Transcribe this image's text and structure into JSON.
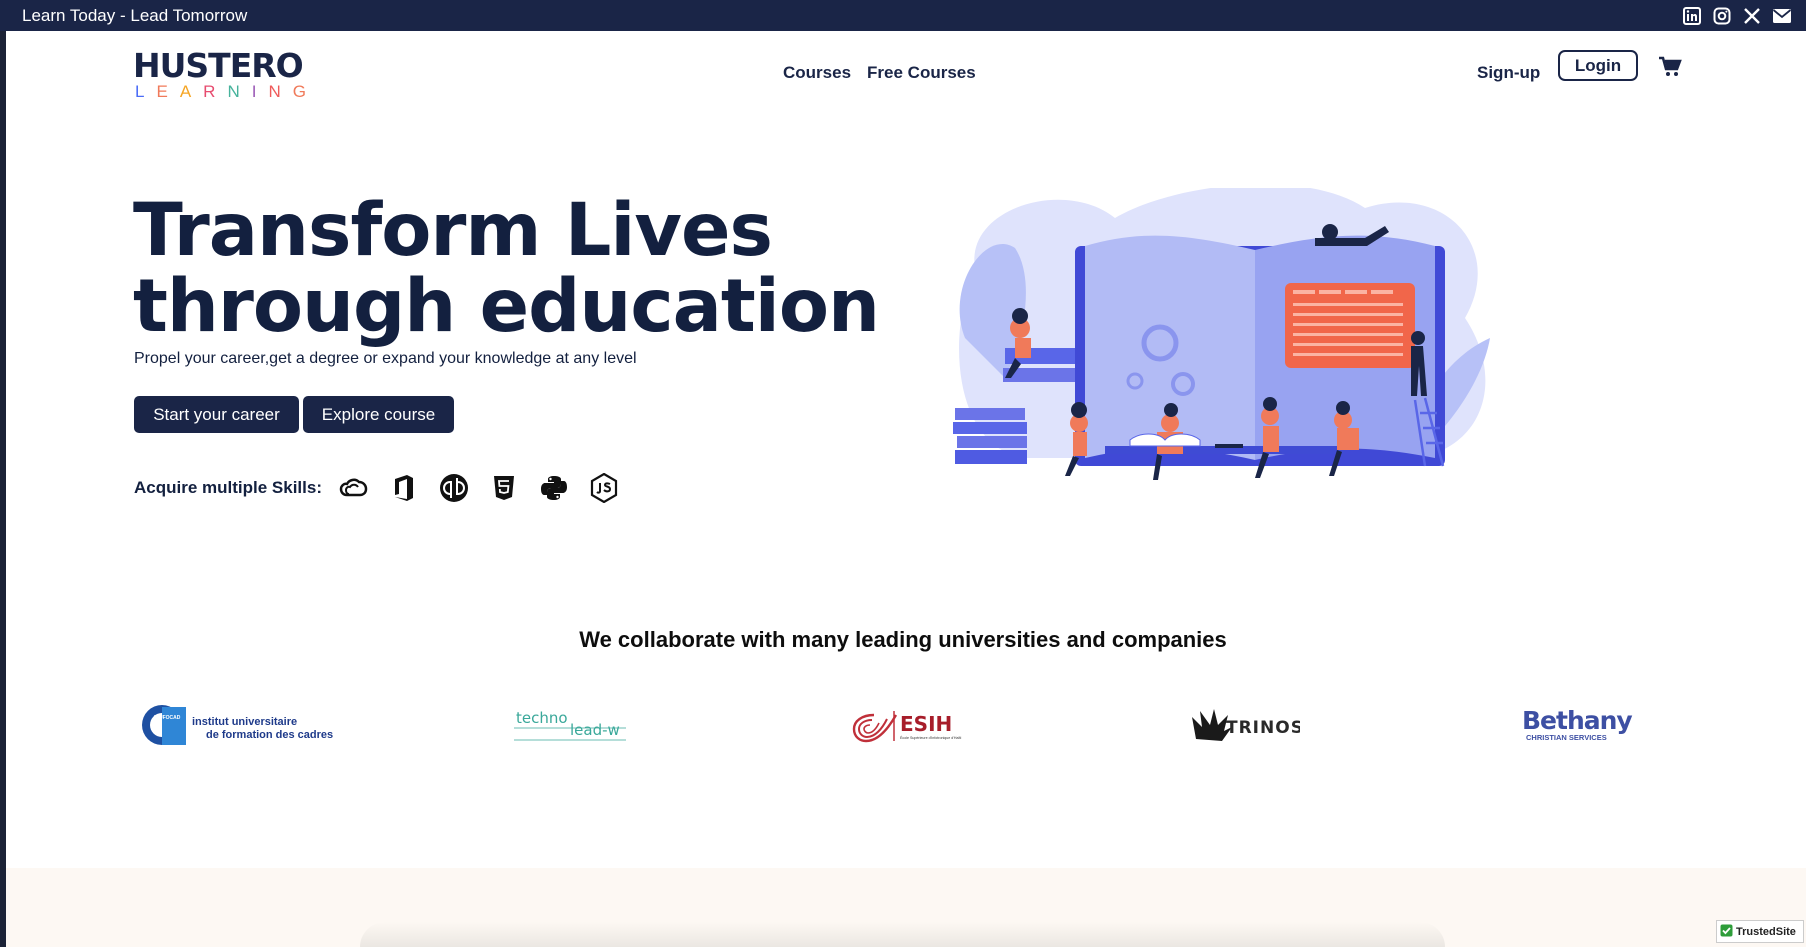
{
  "topbar": {
    "tagline": "Learn Today - Lead Tomorrow",
    "social_icons": [
      "linkedin-icon",
      "instagram-icon",
      "x-icon",
      "mail-icon"
    ]
  },
  "header": {
    "logo_top": "HUSTERO",
    "logo_bottom": [
      "L",
      "E",
      "A",
      "R",
      "N",
      "I",
      "N",
      "G"
    ],
    "nav": [
      "Courses",
      "Free Courses"
    ],
    "signup": "Sign-up",
    "login": "Login"
  },
  "hero": {
    "title_line1": "Transform Lives",
    "title_line2": "through education",
    "subtitle": "Propel your career,get a degree or expand your knowledge at any level",
    "primary_button": "Start your career",
    "secondary_button": "Explore course",
    "skills_label": "Acquire multiple Skills:",
    "skill_icons": [
      "creative-cloud-icon",
      "office-icon",
      "quickbooks-icon",
      "html5-icon",
      "python-icon",
      "nodejs-icon"
    ]
  },
  "collab": {
    "heading": "We collaborate with many leading universities and companies",
    "partners": {
      "iufc_badge": "INUFOCAD",
      "iufc_line1": "institut universitaire",
      "iufc_line2": "de formation des cadres",
      "techno": "techno",
      "lead": "lead-w",
      "esih": "ESIH",
      "esih_small": "École Supérieure d'Infotronique d'Haïti",
      "trinos": "TRINOS",
      "bethany": "Bethany",
      "bethany_sub": "CHRISTIAN SERVICES"
    }
  },
  "badge": {
    "trusted": "TrustedSite"
  },
  "colors": {
    "navy": "#1a2547",
    "accent_orange": "#f07a5a",
    "illustration_blue": "#5966e8"
  }
}
